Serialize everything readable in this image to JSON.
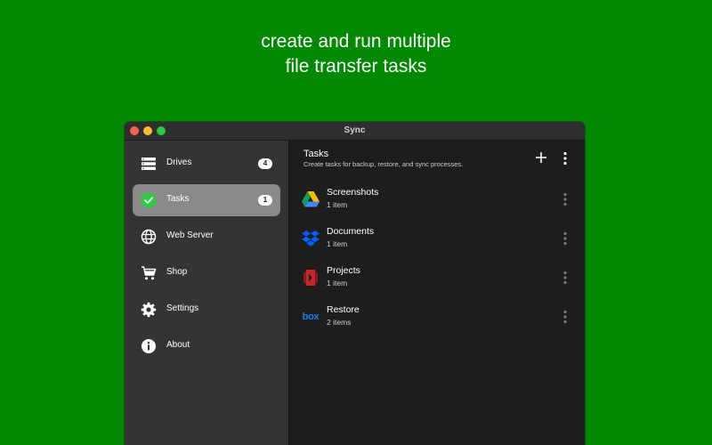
{
  "headline": {
    "line1": "create and run multiple",
    "line2": "file transfer tasks"
  },
  "window": {
    "title": "Sync"
  },
  "sidebar": {
    "items": [
      {
        "label": "Drives",
        "badge": "4",
        "icon": "drives-icon"
      },
      {
        "label": "Tasks",
        "badge": "1",
        "icon": "check-circle-icon",
        "active": true
      },
      {
        "label": "Web Server",
        "icon": "globe-icon"
      },
      {
        "label": "Shop",
        "icon": "cart-icon"
      },
      {
        "label": "Settings",
        "icon": "gear-icon"
      },
      {
        "label": "About",
        "icon": "info-icon"
      }
    ]
  },
  "main": {
    "title": "Tasks",
    "subtitle": "Create tasks for backup, restore, and sync processes.",
    "tasks": [
      {
        "name": "Screenshots",
        "count": "1 item",
        "icon": "google-drive-icon"
      },
      {
        "name": "Documents",
        "count": "1 item",
        "icon": "dropbox-icon"
      },
      {
        "name": "Projects",
        "count": "1 item",
        "icon": "red-drive-icon"
      },
      {
        "name": "Restore",
        "count": "2 items",
        "icon": "box-icon",
        "icon_text": "box"
      }
    ]
  },
  "colors": {
    "background": "#018a01",
    "sidebar": "#343434",
    "main": "#1d1d1d",
    "active_item": "#8a8a8a",
    "check_green": "#2ecc40"
  }
}
